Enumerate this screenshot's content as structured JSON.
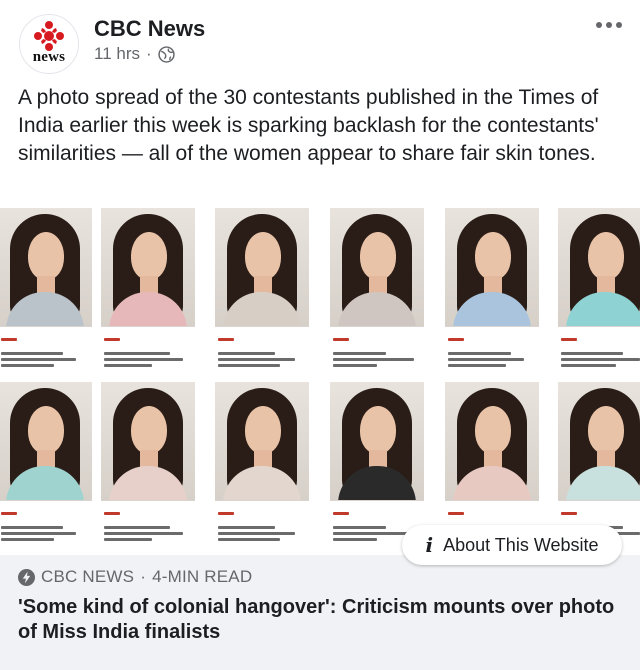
{
  "header": {
    "page_name": "CBC News",
    "avatar_text": "news",
    "timestamp": "11 hrs",
    "separator": "·"
  },
  "post": {
    "text": "A photo spread of the 30 contestants published in the Times of India earlier this week is sparking backlash for the contestants' similarities — all of the women appear to share fair skin tones."
  },
  "photo": {
    "dress_colors_row1": [
      "#b9c3c9",
      "#e6b8b9",
      "#d7cfc6",
      "#cfc6c1",
      "#a9c4dc",
      "#8fd2d4"
    ],
    "dress_colors_row2": [
      "#9fd3cf",
      "#e7d0c9",
      "#e3d6cf",
      "#2a2a2a",
      "#e8c9c2",
      "#c8e1de"
    ]
  },
  "about_button": {
    "icon": "i",
    "label": "About This Website"
  },
  "link": {
    "source": "CBC NEWS",
    "separator": "·",
    "read_time": "4-MIN READ",
    "headline": "'Some kind of colonial hangover': Criticism mounts over photo of Miss India finalists"
  },
  "colors": {
    "brand_red": "#d71920",
    "meta_gray": "#65676b",
    "preview_bg": "#f0f2f5"
  },
  "icons": {
    "avatar": "cbc-gem-logo",
    "privacy": "globe-icon",
    "menu": "more-options-icon",
    "source": "lightning-bolt-icon",
    "about": "info-icon"
  }
}
